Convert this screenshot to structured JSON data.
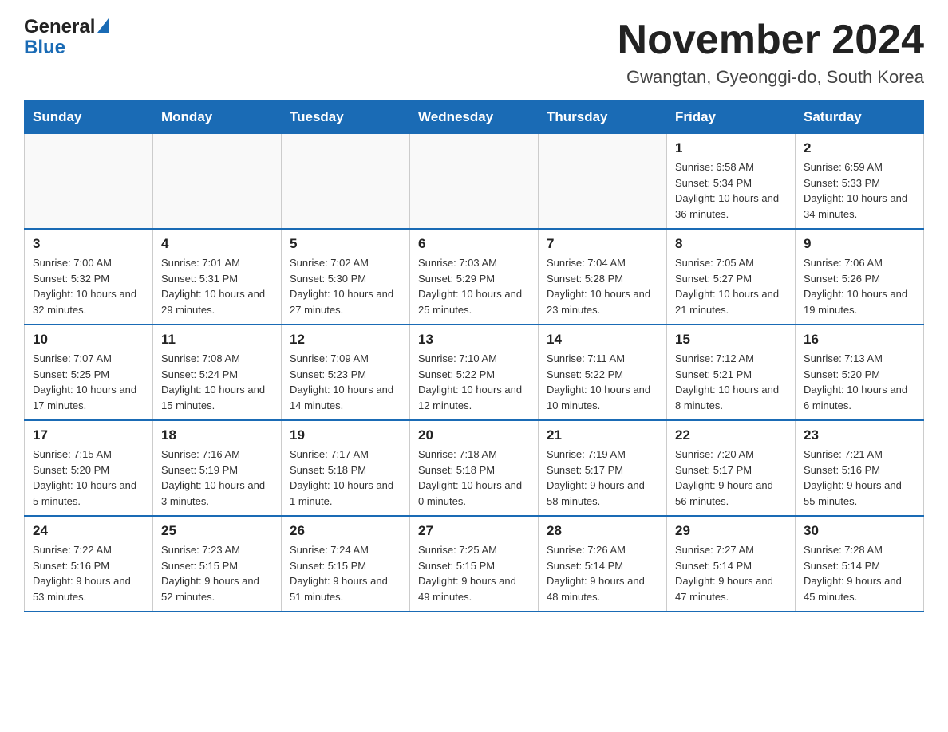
{
  "header": {
    "logo_general": "General",
    "logo_blue": "Blue",
    "month_title": "November 2024",
    "location": "Gwangtan, Gyeonggi-do, South Korea"
  },
  "days_of_week": [
    "Sunday",
    "Monday",
    "Tuesday",
    "Wednesday",
    "Thursday",
    "Friday",
    "Saturday"
  ],
  "weeks": [
    [
      {
        "day": "",
        "info": ""
      },
      {
        "day": "",
        "info": ""
      },
      {
        "day": "",
        "info": ""
      },
      {
        "day": "",
        "info": ""
      },
      {
        "day": "",
        "info": ""
      },
      {
        "day": "1",
        "info": "Sunrise: 6:58 AM\nSunset: 5:34 PM\nDaylight: 10 hours and 36 minutes."
      },
      {
        "day": "2",
        "info": "Sunrise: 6:59 AM\nSunset: 5:33 PM\nDaylight: 10 hours and 34 minutes."
      }
    ],
    [
      {
        "day": "3",
        "info": "Sunrise: 7:00 AM\nSunset: 5:32 PM\nDaylight: 10 hours and 32 minutes."
      },
      {
        "day": "4",
        "info": "Sunrise: 7:01 AM\nSunset: 5:31 PM\nDaylight: 10 hours and 29 minutes."
      },
      {
        "day": "5",
        "info": "Sunrise: 7:02 AM\nSunset: 5:30 PM\nDaylight: 10 hours and 27 minutes."
      },
      {
        "day": "6",
        "info": "Sunrise: 7:03 AM\nSunset: 5:29 PM\nDaylight: 10 hours and 25 minutes."
      },
      {
        "day": "7",
        "info": "Sunrise: 7:04 AM\nSunset: 5:28 PM\nDaylight: 10 hours and 23 minutes."
      },
      {
        "day": "8",
        "info": "Sunrise: 7:05 AM\nSunset: 5:27 PM\nDaylight: 10 hours and 21 minutes."
      },
      {
        "day": "9",
        "info": "Sunrise: 7:06 AM\nSunset: 5:26 PM\nDaylight: 10 hours and 19 minutes."
      }
    ],
    [
      {
        "day": "10",
        "info": "Sunrise: 7:07 AM\nSunset: 5:25 PM\nDaylight: 10 hours and 17 minutes."
      },
      {
        "day": "11",
        "info": "Sunrise: 7:08 AM\nSunset: 5:24 PM\nDaylight: 10 hours and 15 minutes."
      },
      {
        "day": "12",
        "info": "Sunrise: 7:09 AM\nSunset: 5:23 PM\nDaylight: 10 hours and 14 minutes."
      },
      {
        "day": "13",
        "info": "Sunrise: 7:10 AM\nSunset: 5:22 PM\nDaylight: 10 hours and 12 minutes."
      },
      {
        "day": "14",
        "info": "Sunrise: 7:11 AM\nSunset: 5:22 PM\nDaylight: 10 hours and 10 minutes."
      },
      {
        "day": "15",
        "info": "Sunrise: 7:12 AM\nSunset: 5:21 PM\nDaylight: 10 hours and 8 minutes."
      },
      {
        "day": "16",
        "info": "Sunrise: 7:13 AM\nSunset: 5:20 PM\nDaylight: 10 hours and 6 minutes."
      }
    ],
    [
      {
        "day": "17",
        "info": "Sunrise: 7:15 AM\nSunset: 5:20 PM\nDaylight: 10 hours and 5 minutes."
      },
      {
        "day": "18",
        "info": "Sunrise: 7:16 AM\nSunset: 5:19 PM\nDaylight: 10 hours and 3 minutes."
      },
      {
        "day": "19",
        "info": "Sunrise: 7:17 AM\nSunset: 5:18 PM\nDaylight: 10 hours and 1 minute."
      },
      {
        "day": "20",
        "info": "Sunrise: 7:18 AM\nSunset: 5:18 PM\nDaylight: 10 hours and 0 minutes."
      },
      {
        "day": "21",
        "info": "Sunrise: 7:19 AM\nSunset: 5:17 PM\nDaylight: 9 hours and 58 minutes."
      },
      {
        "day": "22",
        "info": "Sunrise: 7:20 AM\nSunset: 5:17 PM\nDaylight: 9 hours and 56 minutes."
      },
      {
        "day": "23",
        "info": "Sunrise: 7:21 AM\nSunset: 5:16 PM\nDaylight: 9 hours and 55 minutes."
      }
    ],
    [
      {
        "day": "24",
        "info": "Sunrise: 7:22 AM\nSunset: 5:16 PM\nDaylight: 9 hours and 53 minutes."
      },
      {
        "day": "25",
        "info": "Sunrise: 7:23 AM\nSunset: 5:15 PM\nDaylight: 9 hours and 52 minutes."
      },
      {
        "day": "26",
        "info": "Sunrise: 7:24 AM\nSunset: 5:15 PM\nDaylight: 9 hours and 51 minutes."
      },
      {
        "day": "27",
        "info": "Sunrise: 7:25 AM\nSunset: 5:15 PM\nDaylight: 9 hours and 49 minutes."
      },
      {
        "day": "28",
        "info": "Sunrise: 7:26 AM\nSunset: 5:14 PM\nDaylight: 9 hours and 48 minutes."
      },
      {
        "day": "29",
        "info": "Sunrise: 7:27 AM\nSunset: 5:14 PM\nDaylight: 9 hours and 47 minutes."
      },
      {
        "day": "30",
        "info": "Sunrise: 7:28 AM\nSunset: 5:14 PM\nDaylight: 9 hours and 45 minutes."
      }
    ]
  ]
}
